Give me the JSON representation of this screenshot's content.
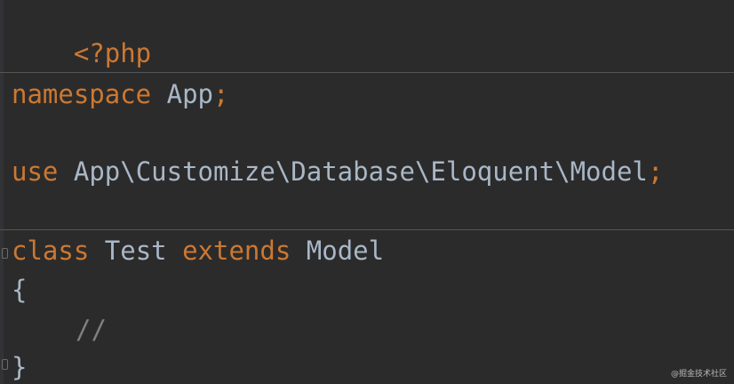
{
  "code": {
    "line1": {
      "open_tag": "<?php"
    },
    "line3": {
      "keyword": "namespace",
      "name": "App",
      "semicolon": ";"
    },
    "line5": {
      "keyword": "use",
      "path": "App\\Customize\\Database\\Eloquent\\Model",
      "semicolon": ";"
    },
    "line7": {
      "keyword_class": "class",
      "class_name": "Test",
      "keyword_extends": "extends",
      "parent": "Model"
    },
    "line8": {
      "brace": "{"
    },
    "line9": {
      "comment": "//"
    },
    "line10": {
      "brace": "}"
    }
  },
  "watermark": "@掘金技术社区",
  "colors": {
    "background": "#2b2b2b",
    "keyword": "#cc7832",
    "identifier": "#a9b7c6",
    "comment": "#808080",
    "separator": "#555555"
  }
}
